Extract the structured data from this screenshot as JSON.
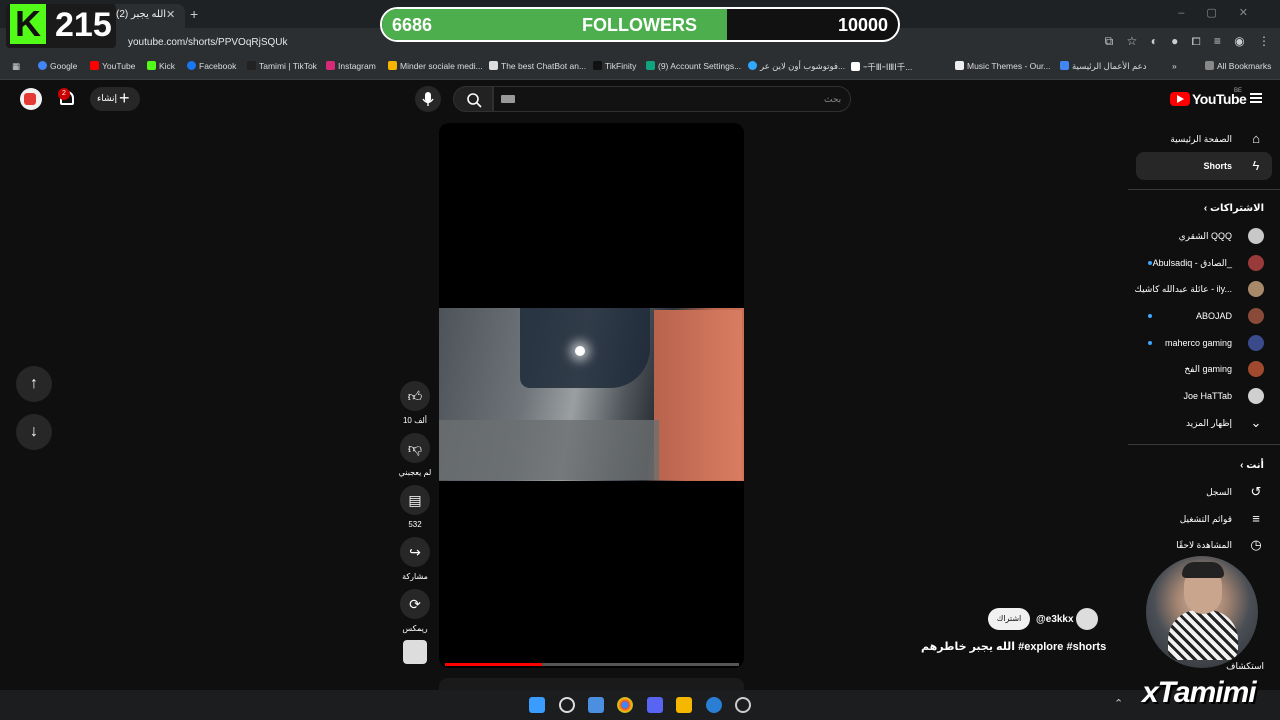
{
  "browser": {
    "tab_title": "(2) الله يجبر",
    "url": "youtube.com/shorts/PPVOqRjSQUk",
    "bookmarks": [
      "Google",
      "YouTube",
      "Kick",
      "Facebook",
      "Tamimi | TikTok",
      "Instagram",
      "Minder sociale medi...",
      "The best ChatBot an...",
      "TikFinity",
      "(9) Account Settings...",
      "فوتوشوب أون لاين عر...",
      "ｰ千ⅢｰⅠⅢⅠ千...",
      "Music Themes - Our...",
      "دعم الأعمال الرئيسية",
      "All Bookmarks"
    ]
  },
  "overlay": {
    "kick_letter": "K",
    "kick_count": "215",
    "followers_current": "6686",
    "followers_label": "FOLLOWERS",
    "followers_goal": "10000",
    "followers_progress": 0.6686,
    "watermark": "xTamimi"
  },
  "youtube": {
    "logo_text": "YouTube",
    "region": "BE",
    "search_placeholder": "بحث",
    "create_label": "إنشاء",
    "notification_count": "2",
    "sidebar": {
      "home": "الصفحة الرئيسية",
      "shorts": "Shorts",
      "subscriptions_head": "الاشتراكات",
      "subscriptions": [
        {
          "name": "الشقري QQQ",
          "color": "#c8c8c8"
        },
        {
          "name": "Abulsadiq - الصادق_",
          "color": "#9a3b3b"
        },
        {
          "name": "عائلة عبدالله كاشيك - ily...",
          "color": "#a88a6a"
        },
        {
          "name": "ABOJAD",
          "color": "#8a4a3a"
        },
        {
          "name": "maherco gaming",
          "color": "#3a4a8a"
        },
        {
          "name": "الفخ gaming",
          "color": "#a0492e"
        },
        {
          "name": "Joe HaTTab",
          "color": "#d0d0d0"
        }
      ],
      "show_more": "إظهار المزيد",
      "you_head": "أنت",
      "you_items": [
        "السجل",
        "قوائم التشغيل",
        "المشاهدة لاحقًا"
      ],
      "explore": "استكشاف"
    },
    "short": {
      "likes": "10 ألف",
      "dislike_label": "لم يعجبني",
      "comments": "532",
      "share_label": "مشاركة",
      "remix_label": "ريمكس",
      "channel": "@e3kkx",
      "subscribe": "اشتراك",
      "title": "الله يجبر خاطرهم #explore #shorts",
      "progress": 0.33
    }
  }
}
